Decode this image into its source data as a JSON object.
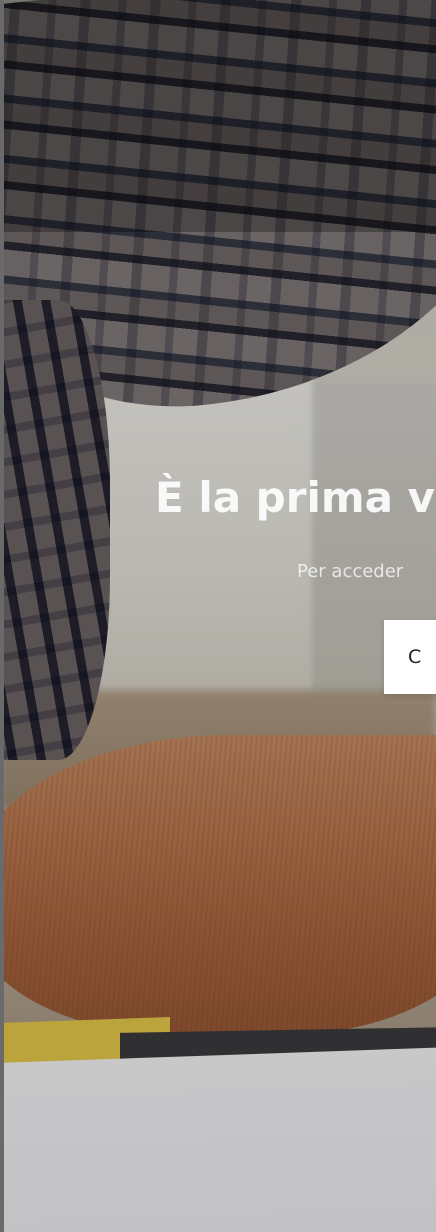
{
  "hero": {
    "title": "È la prima v",
    "subtitle": "Per acceder",
    "cta_label": "C"
  },
  "colors": {
    "title_text": "#ffffff",
    "cta_background": "#ffffff",
    "cta_text": "#222222"
  }
}
